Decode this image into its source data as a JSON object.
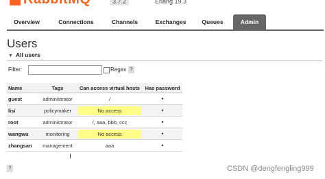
{
  "header": {
    "brand": "RabbitMQ",
    "version": "3.7.2",
    "erlang": "Erlang 19.3"
  },
  "tabs": [
    {
      "label": "Overview"
    },
    {
      "label": "Connections"
    },
    {
      "label": "Channels"
    },
    {
      "label": "Exchanges"
    },
    {
      "label": "Queues"
    },
    {
      "label": "Admin",
      "active": true
    }
  ],
  "page": {
    "title": "Users",
    "section": "All users",
    "filter_label": "Filter:",
    "filter_value": "",
    "regex_label": "Regex",
    "help": "?"
  },
  "table": {
    "headers": [
      "Name",
      "Tags",
      "Can access virtual hosts",
      "Has password"
    ],
    "rows": [
      {
        "name": "guest",
        "tags": "administrator",
        "vhosts": "/",
        "password": "•"
      },
      {
        "name": "lisi",
        "tags": "policymaker",
        "vhosts": "No access",
        "password": "•"
      },
      {
        "name": "root",
        "tags": "administrator",
        "vhosts": "/, aaa, bbb, ccc",
        "password": "•"
      },
      {
        "name": "wangwu",
        "tags": "monitoring",
        "vhosts": "No access",
        "password": "•"
      },
      {
        "name": "zhangsan",
        "tags": "management",
        "vhosts": "aaa",
        "password": "•"
      }
    ]
  },
  "footer": {
    "help": "?",
    "watermark": "CSDN @dengfengling999"
  },
  "colors": {
    "brand": "#f26522",
    "active_tab": "#666666",
    "no_access": "#ffff88"
  }
}
